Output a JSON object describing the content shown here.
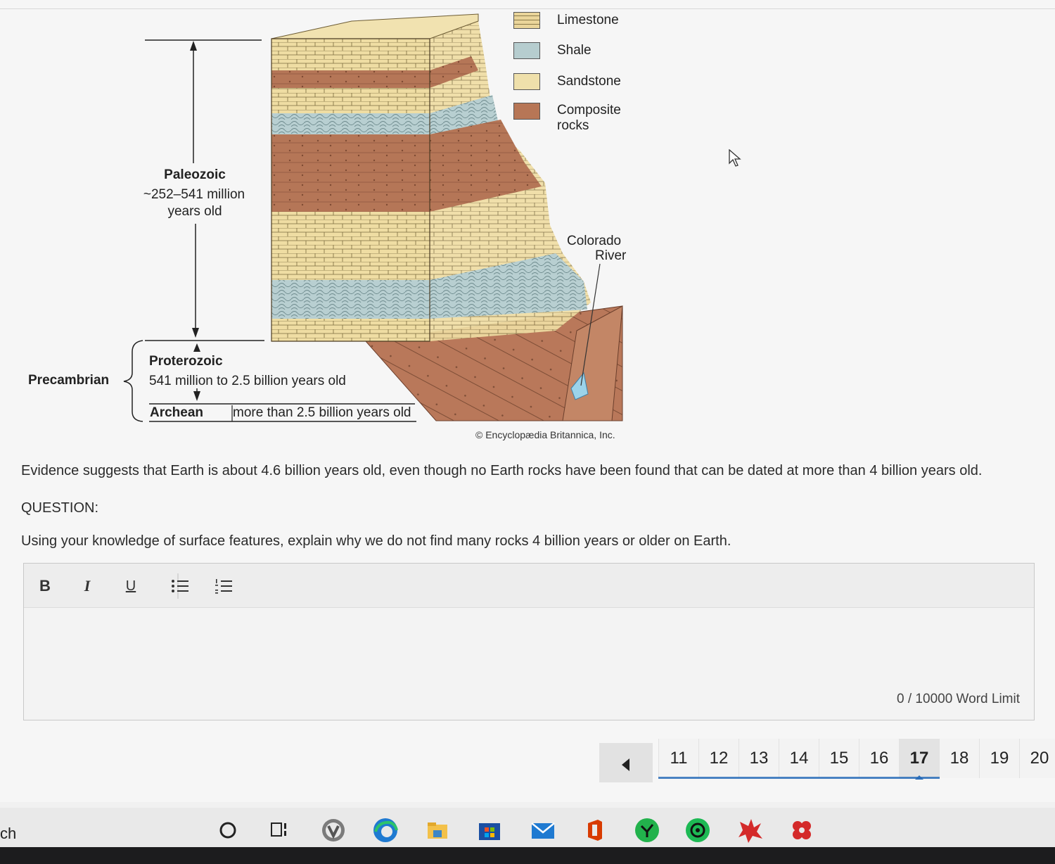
{
  "figure": {
    "legend": [
      {
        "label": "Limestone",
        "color": "#ead59a"
      },
      {
        "label": "Shale",
        "color": "#b6cdcf"
      },
      {
        "label": "Sandstone",
        "color": "#efe0ab"
      },
      {
        "label": "Composite rocks",
        "color": "#b77656"
      }
    ],
    "paleozoic": {
      "title": "Paleozoic",
      "line1": "~252–541 million",
      "line2": "years old"
    },
    "precambrian_label": "Precambrian",
    "proterozoic": {
      "title": "Proterozoic",
      "desc": "541 million to 2.5 billion years old"
    },
    "archean": {
      "title": "Archean",
      "desc": "more than 2.5 billion years old"
    },
    "river": {
      "line1": "Colorado",
      "line2": "River"
    },
    "credit": "© Encyclopædia Britannica, Inc."
  },
  "question": {
    "evidence": "Evidence suggests that Earth is about 4.6 billion years old, even though no Earth rocks have been found that can be dated at more than 4 billion years old.",
    "heading": "QUESTION:",
    "prompt": "Using your knowledge of surface features, explain why we do not find many rocks 4 billion years or older on Earth."
  },
  "editor": {
    "toolbar": {
      "bold": "B",
      "italic": "I",
      "underline": "U"
    },
    "value": "",
    "word_limit": "0 / 10000 Word Limit"
  },
  "pagination": {
    "pages": [
      "11",
      "12",
      "13",
      "14",
      "15",
      "16",
      "17",
      "18",
      "19",
      "20"
    ],
    "current": "17"
  },
  "taskbar": {
    "search_text": "ch",
    "apps": [
      "cortana-icon",
      "task-view-icon",
      "overwatch-icon",
      "edge-icon",
      "file-explorer-icon",
      "store-icon",
      "mail-icon",
      "office-icon",
      "green-app-icon",
      "spotify-like-icon",
      "red-app-icon",
      "red-app-2-icon"
    ]
  }
}
